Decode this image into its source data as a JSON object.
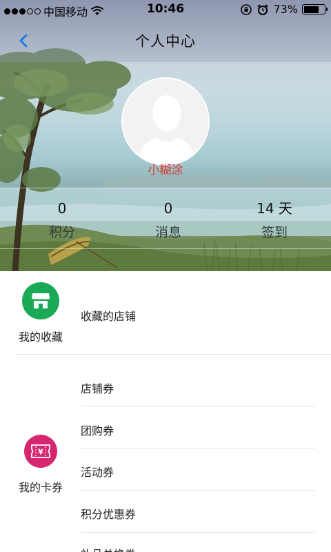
{
  "status_bar": {
    "carrier": "中国移动",
    "time": "10:46",
    "battery_percent": "73%",
    "battery_level": 0.73
  },
  "nav": {
    "title": "个人中心",
    "back_icon": "chevron-left-icon"
  },
  "profile": {
    "username": "小糊涂",
    "avatar_icon": "default-avatar-icon"
  },
  "stats": [
    {
      "value": "0",
      "label": "积分"
    },
    {
      "value": "0",
      "label": "消息"
    },
    {
      "value": "14 天",
      "label": "签到"
    }
  ],
  "favorites": {
    "label": "我的收藏",
    "icon": "store-icon",
    "icon_color": "#1aaa55",
    "items": [
      "收藏的店铺"
    ]
  },
  "coupons": {
    "label": "我的卡券",
    "icon": "ticket-icon",
    "icon_color": "#d6266f",
    "items": [
      "店铺券",
      "团购券",
      "活动券",
      "积分优惠券",
      "礼品兑换券"
    ]
  },
  "colors": {
    "accent_blue": "#1a7ae8",
    "username_red": "#e0362c"
  }
}
